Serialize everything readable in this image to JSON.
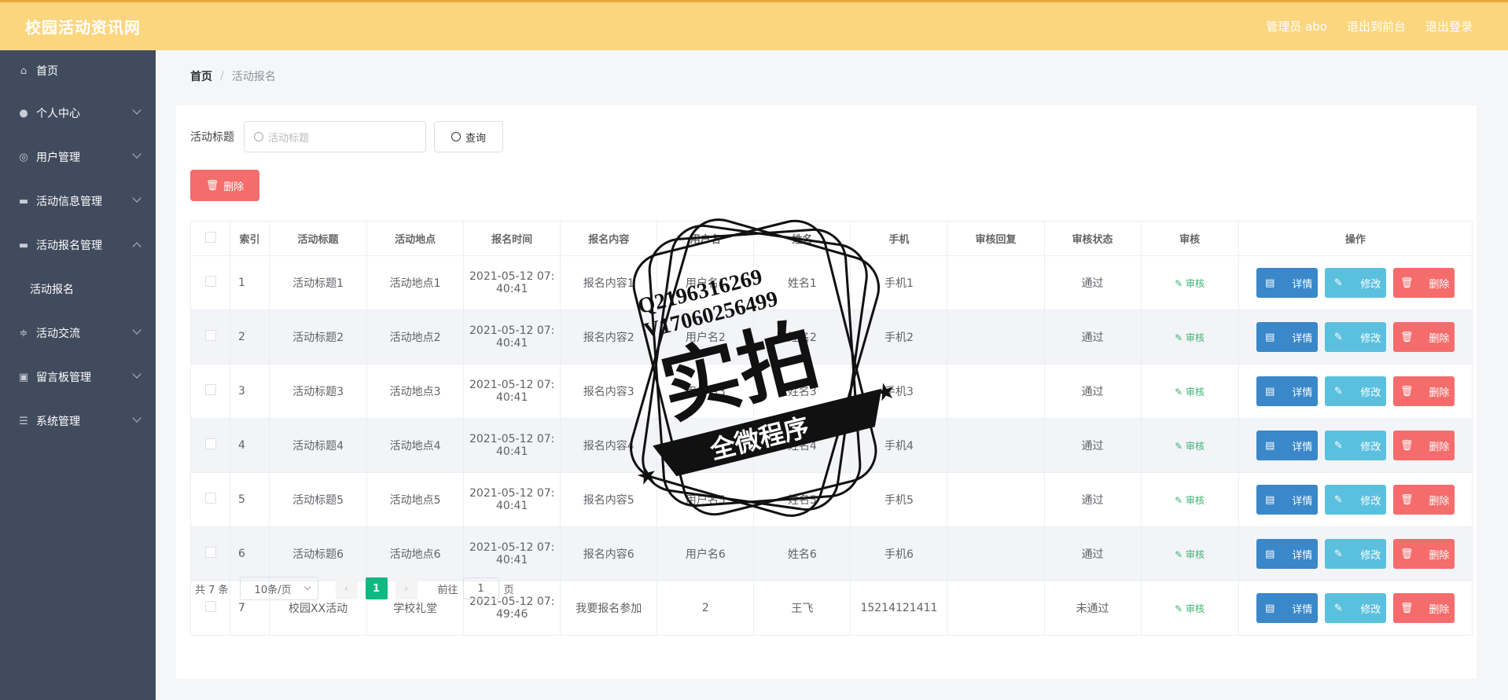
{
  "header": {
    "logo": "校园活动资讯网",
    "links": [
      "管理员 abo",
      "退出到前台",
      "退出登录"
    ]
  },
  "sidebar": {
    "items": [
      {
        "label": "首页",
        "icon": "home-icon"
      },
      {
        "label": "个人中心",
        "icon": "user-icon"
      },
      {
        "label": "用户管理",
        "icon": "users-icon"
      },
      {
        "label": "活动信息管理",
        "icon": "info-icon"
      },
      {
        "label": "活动报名管理",
        "icon": "signup-icon"
      },
      {
        "label": "活动报名",
        "icon": ""
      },
      {
        "label": "活动交流",
        "icon": "chat-icon"
      },
      {
        "label": "留言板管理",
        "icon": "board-icon"
      },
      {
        "label": "系统管理",
        "icon": "system-icon"
      }
    ]
  },
  "breadcrumb": {
    "home": "首页",
    "current": "活动报名"
  },
  "search": {
    "label": "活动标题",
    "placeholder": "活动标题",
    "query_label": "查询",
    "delete_label": "删除"
  },
  "table": {
    "headers": [
      "索引",
      "活动标题",
      "活动地点",
      "报名时间",
      "报名内容",
      "用户名",
      "姓名",
      "手机",
      "审核回复",
      "审核状态",
      "审核",
      "操作"
    ],
    "rows": [
      {
        "idx": "1",
        "title": "活动标题1",
        "place": "活动地点1",
        "time1": "2021-05-12 07:",
        "time2": "40:41",
        "content": "报名内容1",
        "user": "用户名1",
        "name": "姓名1",
        "phone": "手机1",
        "reply": "",
        "status": "通过"
      },
      {
        "idx": "2",
        "title": "活动标题2",
        "place": "活动地点2",
        "time1": "2021-05-12 07:",
        "time2": "40:41",
        "content": "报名内容2",
        "user": "用户名2",
        "name": "姓名2",
        "phone": "手机2",
        "reply": "",
        "status": "通过"
      },
      {
        "idx": "3",
        "title": "活动标题3",
        "place": "活动地点3",
        "time1": "2021-05-12 07:",
        "time2": "40:41",
        "content": "报名内容3",
        "user": "用户名3",
        "name": "姓名3",
        "phone": "手机3",
        "reply": "",
        "status": "通过"
      },
      {
        "idx": "4",
        "title": "活动标题4",
        "place": "活动地点4",
        "time1": "2021-05-12 07:",
        "time2": "40:41",
        "content": "报名内容4",
        "user": "用户名4",
        "name": "姓名4",
        "phone": "手机4",
        "reply": "",
        "status": "通过"
      },
      {
        "idx": "5",
        "title": "活动标题5",
        "place": "活动地点5",
        "time1": "2021-05-12 07:",
        "time2": "40:41",
        "content": "报名内容5",
        "user": "用户名5",
        "name": "姓名5",
        "phone": "手机5",
        "reply": "",
        "status": "通过"
      },
      {
        "idx": "6",
        "title": "活动标题6",
        "place": "活动地点6",
        "time1": "2021-05-12 07:",
        "time2": "40:41",
        "content": "报名内容6",
        "user": "用户名6",
        "name": "姓名6",
        "phone": "手机6",
        "reply": "",
        "status": "通过"
      },
      {
        "idx": "7",
        "title": "校园XX活动",
        "place": "学校礼堂",
        "time1": "2021-05-12 07:",
        "time2": "49:46",
        "content": "我要报名参加",
        "user": "2",
        "name": "王飞",
        "phone": "15214121411",
        "reply": "",
        "status": "未通过"
      }
    ],
    "audit_label": "审核",
    "detail_label": "详情",
    "edit_label": "修改",
    "delete_label": "删除"
  },
  "pagination": {
    "total": "共 7 条",
    "page_size": "10条/页",
    "current_page": "1",
    "goto_prefix": "前往",
    "goto_value": "1",
    "goto_suffix": "页"
  },
  "watermark": {
    "line1": "Q2196316269",
    "line2": "V17060256499",
    "main": "实拍",
    "ribbon": "全微程序"
  },
  "colors": {
    "header_bg": "#fcd67f",
    "sidebar_bg": "#414b5e",
    "detail_btn": "#3a87c9",
    "edit_btn": "#5bc0de",
    "delete_btn": "#f56c6c",
    "active_page": "#10b981"
  }
}
